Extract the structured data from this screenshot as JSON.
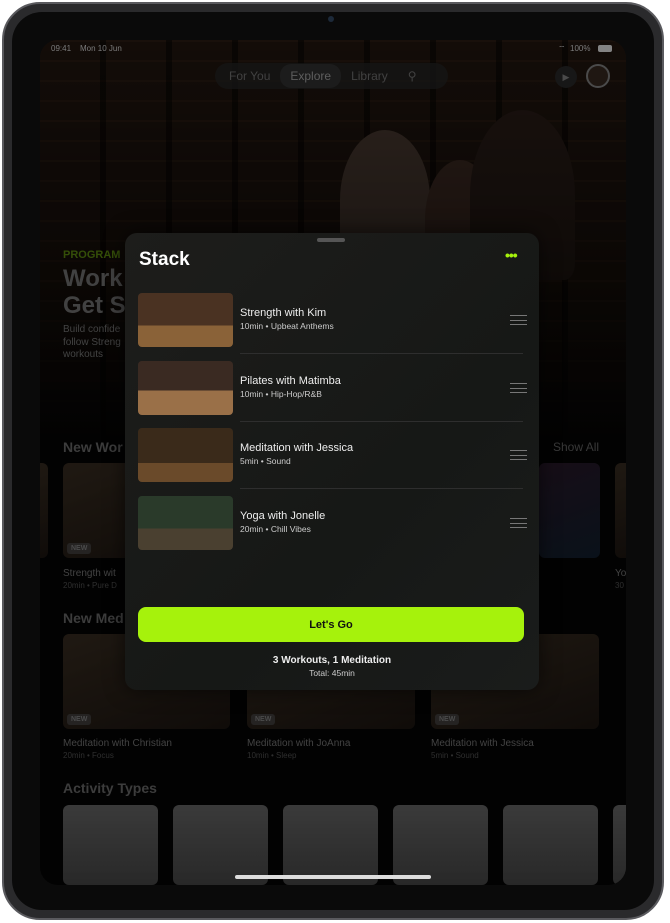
{
  "status": {
    "time": "09:41",
    "date": "Mon 10 Jun",
    "battery": "100%"
  },
  "nav": {
    "tabs": [
      "For You",
      "Explore",
      "Library"
    ],
    "selected": "Explore"
  },
  "program": {
    "label": "PROGRAM",
    "title_line1": "Work",
    "title_line2": "Get S",
    "desc_line1": "Build confide",
    "desc_line2": "follow Streng",
    "desc_line3": "workouts"
  },
  "new_workouts": {
    "title": "New Wor",
    "show_all": "Show All",
    "badge": "NEW",
    "card1_title": "Strength wit",
    "card1_sub": "20min • Pure D",
    "card_right_title": "Yo",
    "card_right_sub": "30"
  },
  "new_meditations": {
    "title": "New Med",
    "badge": "NEW",
    "cards": [
      {
        "title": "Meditation with Christian",
        "sub": "20min • Focus"
      },
      {
        "title": "Meditation with JoAnna",
        "sub": "10min • Sleep"
      },
      {
        "title": "Meditation with Jessica",
        "sub": "5min • Sound"
      }
    ]
  },
  "activity_types": {
    "title": "Activity Types"
  },
  "sheet": {
    "title": "Stack",
    "items": [
      {
        "title": "Strength with Kim",
        "sub": "10min • Upbeat Anthems"
      },
      {
        "title": "Pilates with Matimba",
        "sub": "10min • Hip-Hop/R&B"
      },
      {
        "title": "Meditation with Jessica",
        "sub": "5min • Sound"
      },
      {
        "title": "Yoga with Jonelle",
        "sub": "20min • Chill Vibes"
      }
    ],
    "button": "Let's Go",
    "summary": "3 Workouts, 1 Meditation",
    "total": "Total: 45min"
  },
  "colors": {
    "accent": "#a6f20c"
  }
}
